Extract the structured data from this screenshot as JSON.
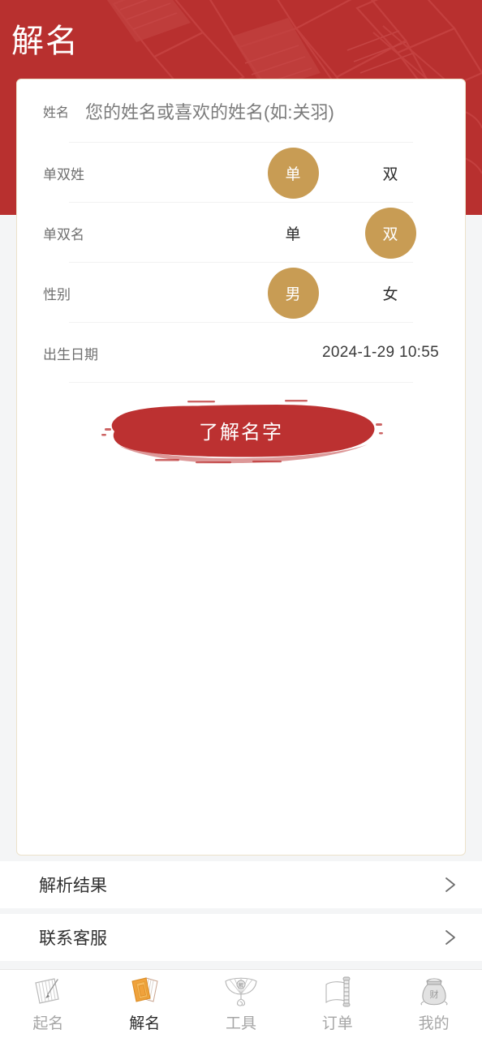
{
  "header": {
    "title": "解名",
    "bg_color": "#b8302f",
    "art_name": "books-scrolls-pattern"
  },
  "card": {
    "border_color": "#ece2cb",
    "rows": [
      {
        "id": "name",
        "label": "姓名",
        "placeholder": "您的姓名或喜欢的姓名(如:关羽)",
        "value": ""
      },
      {
        "id": "surname-type",
        "label": "单双姓",
        "options": [
          {
            "label": "单",
            "selected": true
          },
          {
            "label": "双",
            "selected": false
          }
        ]
      },
      {
        "id": "givenname-type",
        "label": "单双名",
        "options": [
          {
            "label": "单",
            "selected": false
          },
          {
            "label": "双",
            "selected": true
          }
        ]
      },
      {
        "id": "gender",
        "label": "性别",
        "options": [
          {
            "label": "男",
            "selected": true
          },
          {
            "label": "女",
            "selected": false
          }
        ]
      },
      {
        "id": "birth-date",
        "label": "出生日期",
        "value": "2024-1-29 10:55"
      }
    ],
    "cta": {
      "label": "了解名字",
      "color": "#b8302f"
    },
    "accent_color": "#c89c54"
  },
  "list": {
    "items": [
      {
        "label": "解析结果",
        "icon": "chevron-right-icon"
      },
      {
        "label": "联系客服",
        "icon": "chevron-right-icon"
      }
    ]
  },
  "tabbar": {
    "items": [
      {
        "label": "起名",
        "icon": "brush-paper-icon",
        "active": false
      },
      {
        "label": "解名",
        "icon": "open-book-icon",
        "active": true
      },
      {
        "label": "工具",
        "icon": "folding-fan-icon",
        "active": false
      },
      {
        "label": "订单",
        "icon": "scroll-icon",
        "active": false
      },
      {
        "label": "我的",
        "icon": "money-bag-icon",
        "active": false
      }
    ],
    "active_color": "#2b2b2b",
    "inactive_color": "#a6a6a6"
  }
}
